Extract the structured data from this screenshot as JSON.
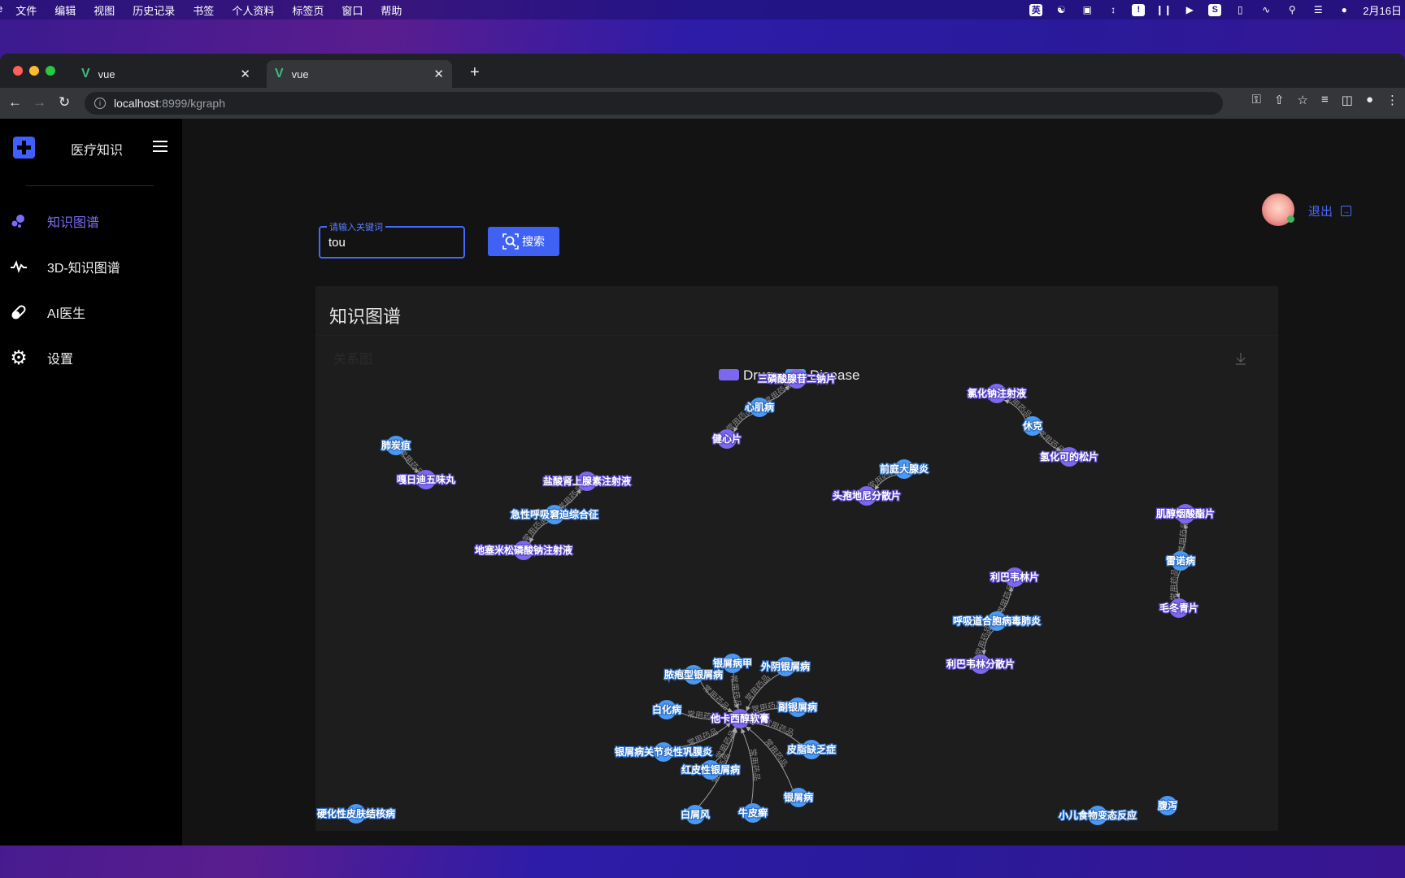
{
  "os_menubar": {
    "app_icon": "e",
    "items": [
      "文件",
      "编辑",
      "视图",
      "历史记录",
      "书签",
      "个人资料",
      "标签页",
      "窗口",
      "帮助"
    ],
    "tray": [
      "英",
      "baidu-netdisk",
      "screen-record",
      "arrows-vertical",
      "notice",
      "airpods",
      "play",
      "s-app",
      "battery",
      "wifi",
      "search",
      "control-center",
      "siri"
    ],
    "date": "2月16日"
  },
  "browser": {
    "tabs": [
      {
        "title": "vue",
        "active": false
      },
      {
        "title": "vue",
        "active": true
      }
    ],
    "url_host": "localhost",
    "url_rest": ":8999/kgraph"
  },
  "sidebar": {
    "brand": "医疗知识",
    "items": [
      {
        "label": "知识图谱",
        "icon": "bubbles-icon",
        "active": true
      },
      {
        "label": "3D-知识图谱",
        "icon": "pulse-icon",
        "active": false
      },
      {
        "label": "AI医生",
        "icon": "pill-icon",
        "active": false
      },
      {
        "label": "设置",
        "icon": "gear-icon",
        "active": false
      }
    ]
  },
  "header": {
    "search_legend": "请输入关键词",
    "search_value": "tou",
    "search_button": "搜索",
    "logout": "退出"
  },
  "card": {
    "title": "知识图谱",
    "subtitle": "关系图"
  },
  "chart_data": {
    "type": "graph",
    "legend": [
      {
        "name": "Drug",
        "color": "#7b68ee"
      },
      {
        "name": "Disease",
        "color": "#4a9af5"
      }
    ],
    "edge_label": "常用药品",
    "nodes": [
      {
        "id": "三磷酸腺苷二钠片",
        "cat": "Drug"
      },
      {
        "id": "心肌病",
        "cat": "Disease"
      },
      {
        "id": "健心片",
        "cat": "Drug"
      },
      {
        "id": "氯化钠注射液",
        "cat": "Drug"
      },
      {
        "id": "休克",
        "cat": "Disease"
      },
      {
        "id": "氢化可的松片",
        "cat": "Drug"
      },
      {
        "id": "肺炭疽",
        "cat": "Disease"
      },
      {
        "id": "嘎日迪五味丸",
        "cat": "Drug"
      },
      {
        "id": "盐酸肾上腺素注射液",
        "cat": "Drug"
      },
      {
        "id": "急性呼吸窘迫综合征",
        "cat": "Disease"
      },
      {
        "id": "地塞米松磷酸钠注射液",
        "cat": "Drug"
      },
      {
        "id": "前庭大腺炎",
        "cat": "Disease"
      },
      {
        "id": "头孢地尼分散片",
        "cat": "Drug"
      },
      {
        "id": "肌醇烟酸酯片",
        "cat": "Drug"
      },
      {
        "id": "雷诺病",
        "cat": "Disease"
      },
      {
        "id": "毛冬青片",
        "cat": "Drug"
      },
      {
        "id": "利巴韦林片",
        "cat": "Drug"
      },
      {
        "id": "呼吸道合胞病毒肺炎",
        "cat": "Disease"
      },
      {
        "id": "利巴韦林分散片",
        "cat": "Drug"
      },
      {
        "id": "他卡西醇软膏",
        "cat": "Drug"
      },
      {
        "id": "银屑病甲",
        "cat": "Disease"
      },
      {
        "id": "外阴银屑病",
        "cat": "Disease"
      },
      {
        "id": "脓疱型银屑病",
        "cat": "Disease"
      },
      {
        "id": "副银屑病",
        "cat": "Disease"
      },
      {
        "id": "白化病",
        "cat": "Disease"
      },
      {
        "id": "皮脂缺乏症",
        "cat": "Disease"
      },
      {
        "id": "银屑病关节炎性巩膜炎",
        "cat": "Disease"
      },
      {
        "id": "红皮性银屑病",
        "cat": "Disease"
      },
      {
        "id": "银屑病",
        "cat": "Disease"
      },
      {
        "id": "白屑风",
        "cat": "Disease"
      },
      {
        "id": "牛皮癣",
        "cat": "Disease"
      },
      {
        "id": "硬化性皮肤结核病",
        "cat": "Disease"
      },
      {
        "id": "小儿食物变态反应",
        "cat": "Disease"
      },
      {
        "id": "腹泻",
        "cat": "Disease"
      }
    ],
    "links": [
      [
        "心肌病",
        "三磷酸腺苷二钠片"
      ],
      [
        "心肌病",
        "健心片"
      ],
      [
        "休克",
        "氯化钠注射液"
      ],
      [
        "休克",
        "氢化可的松片"
      ],
      [
        "肺炭疽",
        "嘎日迪五味丸"
      ],
      [
        "急性呼吸窘迫综合征",
        "盐酸肾上腺素注射液"
      ],
      [
        "急性呼吸窘迫综合征",
        "地塞米松磷酸钠注射液"
      ],
      [
        "前庭大腺炎",
        "头孢地尼分散片"
      ],
      [
        "雷诺病",
        "肌醇烟酸酯片"
      ],
      [
        "雷诺病",
        "毛冬青片"
      ],
      [
        "呼吸道合胞病毒肺炎",
        "利巴韦林片"
      ],
      [
        "呼吸道合胞病毒肺炎",
        "利巴韦林分散片"
      ],
      [
        "银屑病甲",
        "他卡西醇软膏"
      ],
      [
        "外阴银屑病",
        "他卡西醇软膏"
      ],
      [
        "脓疱型银屑病",
        "他卡西醇软膏"
      ],
      [
        "副银屑病",
        "他卡西醇软膏"
      ],
      [
        "白化病",
        "他卡西醇软膏"
      ],
      [
        "皮脂缺乏症",
        "他卡西醇软膏"
      ],
      [
        "银屑病关节炎性巩膜炎",
        "他卡西醇软膏"
      ],
      [
        "红皮性银屑病",
        "他卡西醇软膏"
      ],
      [
        "银屑病",
        "他卡西醇软膏"
      ],
      [
        "白屑风",
        "他卡西醇软膏"
      ],
      [
        "牛皮癣",
        "他卡西醇软膏"
      ]
    ]
  }
}
